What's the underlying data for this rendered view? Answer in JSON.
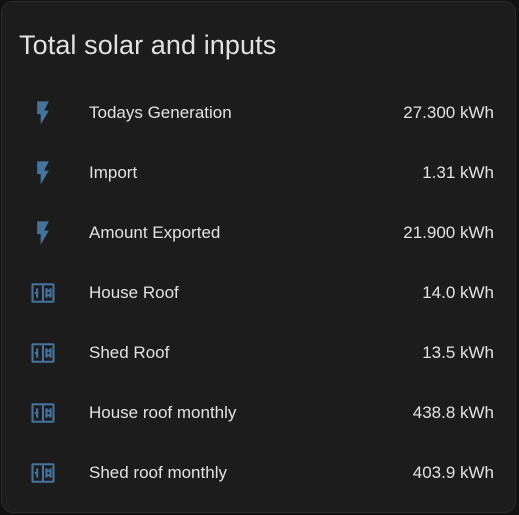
{
  "card": {
    "title": "Total solar and inputs",
    "icon_color": "#44739e",
    "entities": [
      {
        "name": "Todays Generation",
        "value": "27.300 kWh",
        "icon": "flash-icon"
      },
      {
        "name": "Import",
        "value": "1.31 kWh",
        "icon": "flash-icon"
      },
      {
        "name": "Amount Exported",
        "value": "21.900 kWh",
        "icon": "flash-icon"
      },
      {
        "name": "House Roof",
        "value": "14.0 kWh",
        "icon": "solar-panel-icon"
      },
      {
        "name": "Shed Roof",
        "value": "13.5 kWh",
        "icon": "solar-panel-icon"
      },
      {
        "name": "House roof monthly",
        "value": "438.8 kWh",
        "icon": "solar-panel-icon"
      },
      {
        "name": "Shed roof monthly",
        "value": "403.9 kWh",
        "icon": "solar-panel-icon"
      }
    ]
  }
}
